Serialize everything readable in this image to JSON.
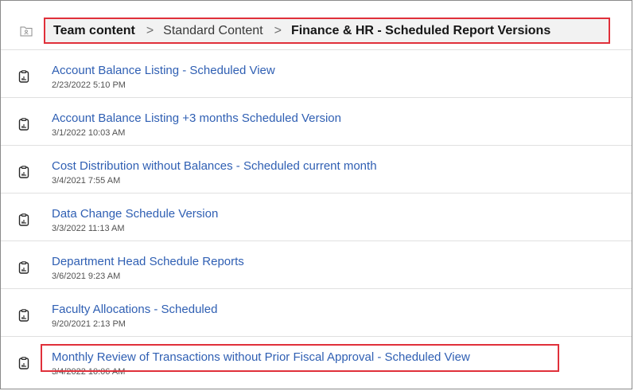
{
  "breadcrumb": {
    "items": [
      "Team content",
      "Standard Content",
      "Finance & HR - Scheduled Report Versions"
    ],
    "separator": ">"
  },
  "reports": [
    {
      "title": "Account Balance Listing - Scheduled View",
      "date": "2/23/2022 5:10 PM"
    },
    {
      "title": "Account Balance Listing +3 months Scheduled Version",
      "date": "3/1/2022 10:03 AM"
    },
    {
      "title": "Cost Distribution without Balances - Scheduled current month",
      "date": "3/4/2021 7:55 AM"
    },
    {
      "title": "Data Change Schedule Version",
      "date": "3/3/2022 11:13 AM"
    },
    {
      "title": "Department Head Schedule Reports",
      "date": "3/6/2021 9:23 AM"
    },
    {
      "title": "Faculty Allocations - Scheduled",
      "date": "9/20/2021 2:13 PM"
    },
    {
      "title": "Monthly Review of Transactions without Prior Fiscal Approval - Scheduled View",
      "date": "3/4/2022 10:06 AM"
    }
  ],
  "icons": {
    "folder": "team-folder-icon",
    "report": "report-view-icon"
  },
  "colors": {
    "link": "#2f5fb3",
    "highlight": "#e0303a",
    "breadcrumb_bg": "#f2f2f2"
  }
}
